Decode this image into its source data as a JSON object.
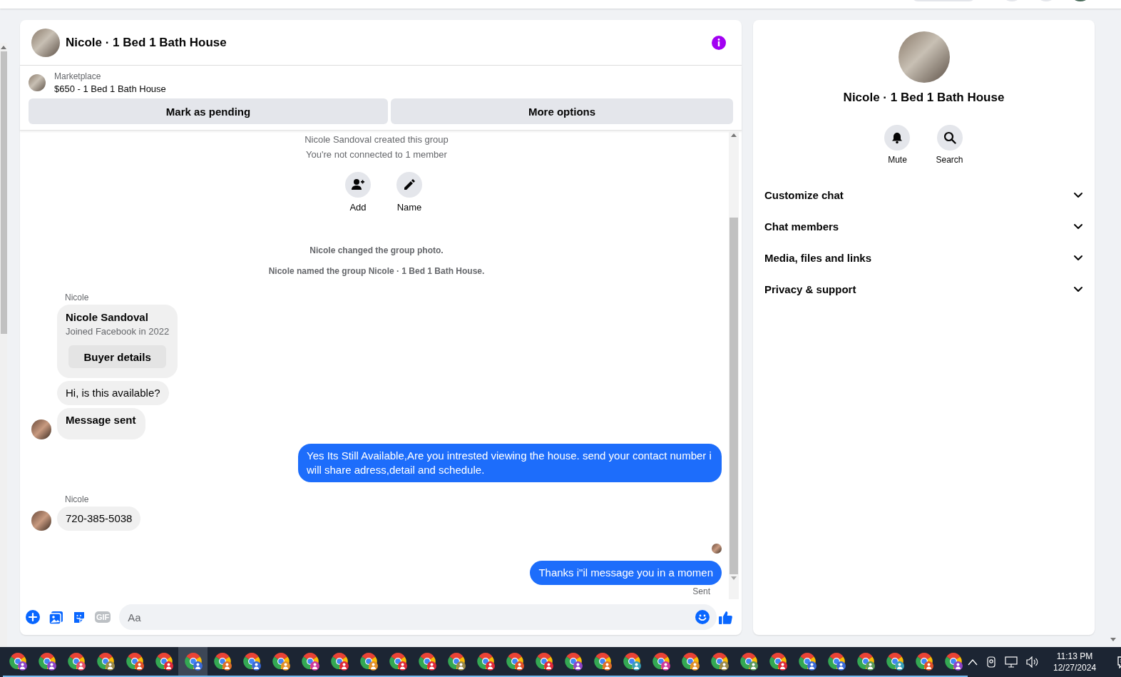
{
  "chat": {
    "title": "Nicole · 1 Bed 1 Bath House",
    "listing": {
      "source": "Marketplace",
      "title": "$650 - 1 Bed 1 Bath House"
    },
    "buttons": [
      "Mark as pending",
      "More options"
    ],
    "messages": [
      {
        "kind": "system",
        "text": "Nicole Sandoval created this group"
      },
      {
        "kind": "system",
        "text": "You're not connected to 1 member"
      },
      {
        "kind": "actions",
        "items": [
          "Add",
          "Name"
        ]
      },
      {
        "kind": "event",
        "text": "Nicole changed the group photo."
      },
      {
        "kind": "event",
        "text": "Nicole named the group Nicole · 1 Bed 1 Bath House."
      },
      {
        "kind": "sender",
        "text": "Nicole"
      },
      {
        "kind": "buyer_card",
        "name": "Nicole Sandoval",
        "subtitle": "Joined Facebook in 2022",
        "button": "Buyer details"
      },
      {
        "kind": "incoming",
        "text": "Hi, is this available?",
        "avatar": false,
        "bold": false
      },
      {
        "kind": "incoming",
        "text": "Message sent",
        "avatar": true,
        "bold": true
      },
      {
        "kind": "outgoing",
        "text": "Yes Its Still Available,Are you intrested viewing the house. send your contact number i will share adress,detail and schedule."
      },
      {
        "kind": "sender",
        "text": "Nicole"
      },
      {
        "kind": "incoming",
        "text": "720-385-5038",
        "avatar": true,
        "bold": false
      },
      {
        "kind": "read_receipt"
      },
      {
        "kind": "outgoing",
        "text": "Thanks i\"il message you in a momen"
      },
      {
        "kind": "status",
        "text": "Sent"
      }
    ],
    "composer": {
      "gif_label": "GIF",
      "placeholder": "Aa"
    }
  },
  "details": {
    "title": "Nicole · 1 Bed 1 Bath House",
    "actions": [
      "Mute",
      "Search"
    ],
    "sections": [
      {
        "label": "Customize chat",
        "expanded": false
      },
      {
        "label": "Chat members",
        "expanded": false
      },
      {
        "label": "Media, files and links",
        "expanded": false
      },
      {
        "label": "Privacy & support",
        "expanded": false
      }
    ]
  },
  "taskbar": {
    "apps": [
      {
        "selected": false,
        "color": "#8e44c8"
      },
      {
        "selected": false,
        "color": "#8e44c8"
      },
      {
        "selected": false,
        "color": "#e8506a"
      },
      {
        "selected": false,
        "color": "#9a8a4a"
      },
      {
        "selected": false,
        "color": "#e0502a"
      },
      {
        "selected": false,
        "color": "#e02a3a"
      },
      {
        "selected": true,
        "color": "#3a6ad8"
      },
      {
        "selected": false,
        "color": "#e0702a"
      },
      {
        "selected": false,
        "color": "#3a6ad8"
      },
      {
        "selected": false,
        "color": "#e0902a"
      },
      {
        "selected": false,
        "color": "#d03a9a"
      },
      {
        "selected": false,
        "color": "#e02a3a"
      },
      {
        "selected": false,
        "color": "#e0902a"
      },
      {
        "selected": false,
        "color": "#e02a3a"
      },
      {
        "selected": false,
        "color": "#e02a3a"
      },
      {
        "selected": false,
        "color": "#9a8a4a"
      },
      {
        "selected": false,
        "color": "#e02a3a"
      },
      {
        "selected": false,
        "color": "#e0502a"
      },
      {
        "selected": false,
        "color": "#e02a3a"
      },
      {
        "selected": false,
        "color": "#8e44c8"
      },
      {
        "selected": false,
        "color": "#e0702a"
      },
      {
        "selected": false,
        "color": "#3aa0b8"
      },
      {
        "selected": false,
        "color": "#d03a9a"
      },
      {
        "selected": false,
        "color": "#e0902a"
      },
      {
        "selected": false,
        "color": "#9a8a4a"
      },
      {
        "selected": false,
        "color": "#5a9a5a"
      },
      {
        "selected": false,
        "color": "#e02a3a"
      },
      {
        "selected": false,
        "color": "#3a6ad8"
      },
      {
        "selected": false,
        "color": "#3a6ad8"
      },
      {
        "selected": false,
        "color": "#5a9a5a"
      },
      {
        "selected": false,
        "color": "#3aa0b8"
      },
      {
        "selected": false,
        "color": "#e0502a"
      },
      {
        "selected": false,
        "color": "#8e44c8"
      }
    ],
    "time": "11:13 PM",
    "date": "12/27/2024"
  }
}
